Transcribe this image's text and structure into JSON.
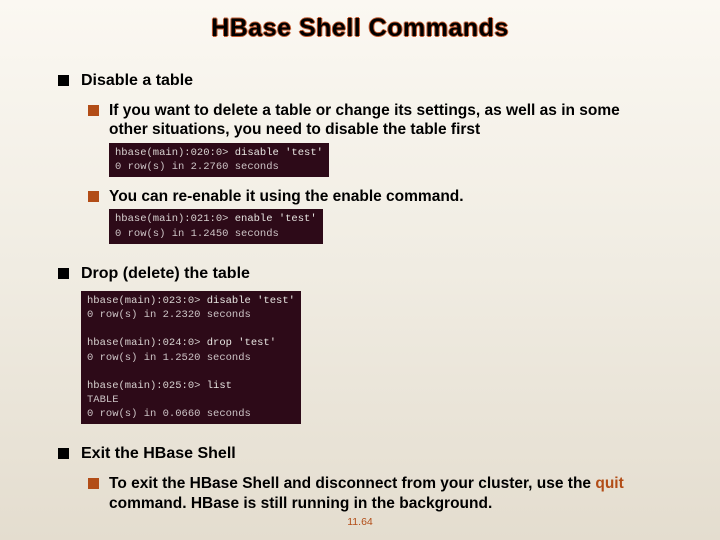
{
  "title": "HBase Shell Commands",
  "page_number": "11.64",
  "sections": [
    {
      "heading": "Disable a table",
      "items": [
        {
          "text": "If you want to delete a table or change its settings, as well as in some other situations, you need to disable the table first",
          "terminal": {
            "l1_prompt": "hbase(main):020:0>",
            "l1_cmd": " disable 'test'",
            "l2": "0 row(s) in 2.2760 seconds"
          }
        },
        {
          "text": "You can re-enable it using the enable command.",
          "terminal": {
            "l1_prompt": "hbase(main):021:0>",
            "l1_cmd": " enable 'test'",
            "l2": "0 row(s) in 1.2450 seconds"
          }
        }
      ]
    },
    {
      "heading": "Drop (delete) the table",
      "terminal_block": {
        "a_prompt": "hbase(main):023:0>",
        "a_cmd": " disable 'test'",
        "a2": "0 row(s) in 2.2320 seconds",
        "b_prompt": "hbase(main):024:0>",
        "b_cmd": " drop 'test'",
        "b2": "0 row(s) in 1.2520 seconds",
        "c_prompt": "hbase(main):025:0>",
        "c_cmd": " list",
        "c2": "TABLE",
        "c3": "0 row(s) in 0.0660 seconds"
      }
    },
    {
      "heading": "Exit the HBase Shell",
      "items": [
        {
          "pre": "To exit the HBase Shell and disconnect from your cluster, use the ",
          "cmd": "quit",
          "post": " command. HBase is still running in the background."
        }
      ]
    }
  ]
}
